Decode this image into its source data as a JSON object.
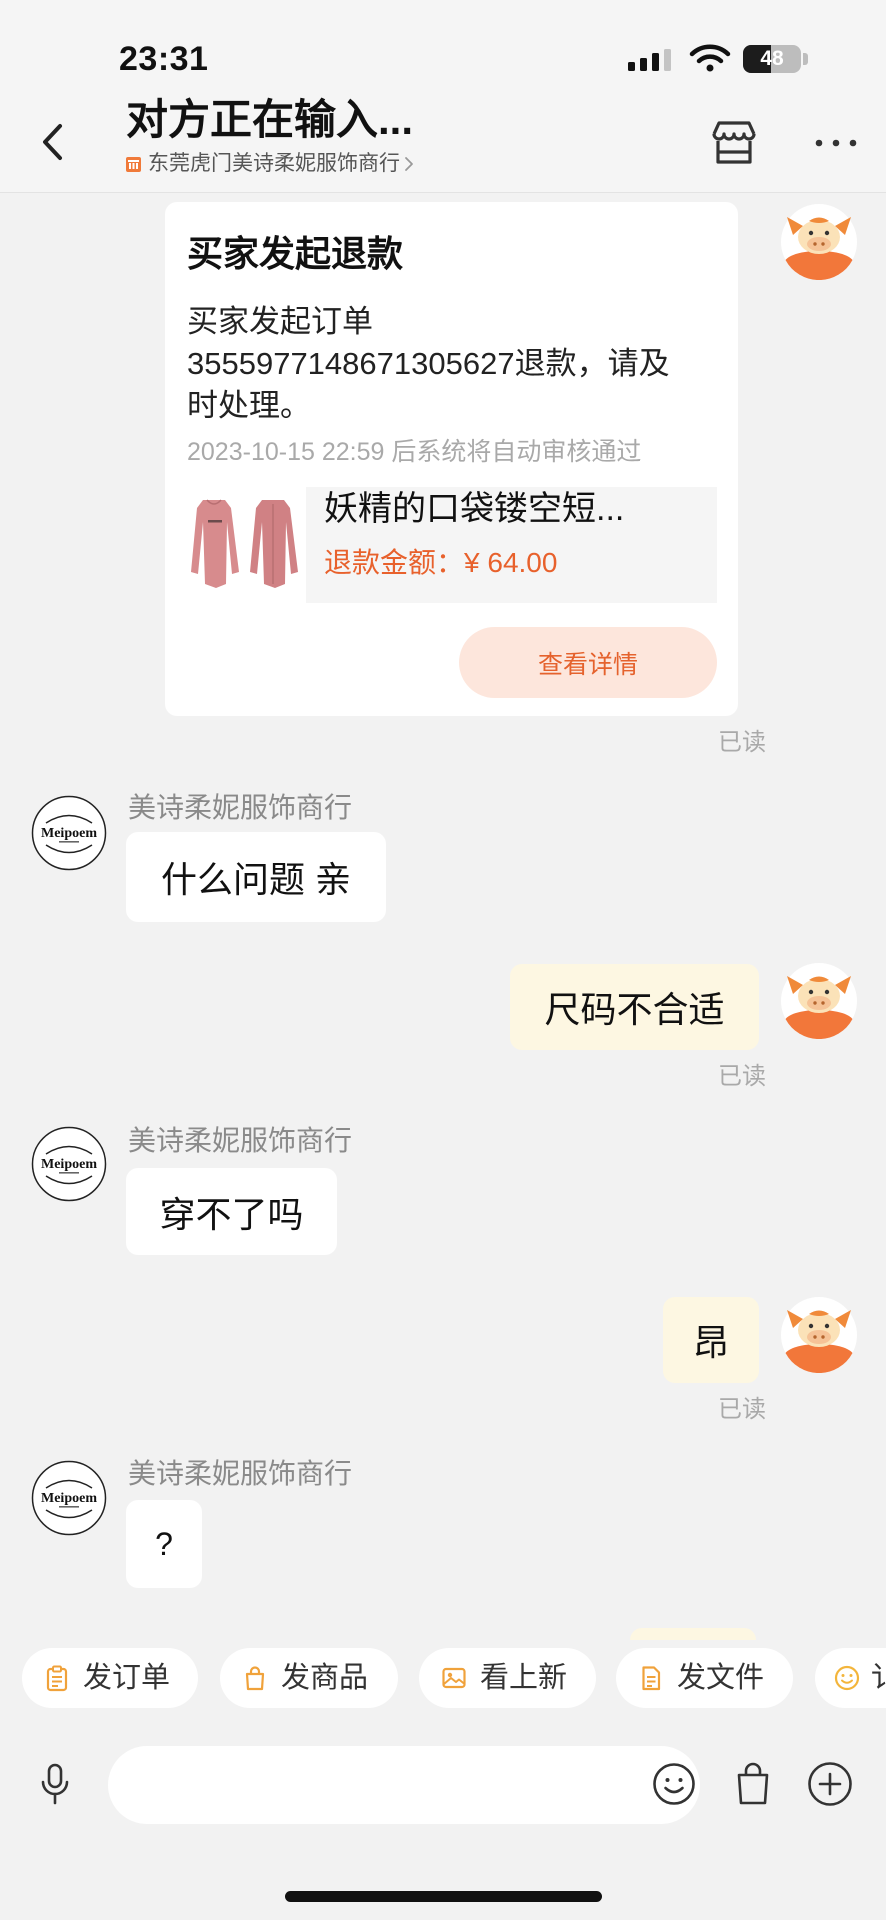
{
  "status_bar": {
    "time": "23:31",
    "battery_percent": "48",
    "battery_level": 0.48,
    "icons": [
      "cellular-signal-icon",
      "wifi-icon",
      "battery-icon"
    ]
  },
  "header": {
    "title": "对方正在输入...",
    "shop_name": "东莞虎门美诗柔妮服饰商行",
    "icons": {
      "back": "chevron-left-icon",
      "shop_badge": "shop-badge-icon",
      "store": "store-icon",
      "more": "more-dots-icon"
    }
  },
  "refund_card": {
    "title": "买家发起退款",
    "body_lines": [
      "买家发起订单",
      "3555977148671305627退款，请及",
      "时处理。"
    ],
    "deadline": "2023-10-15 22:59 后系统将自动审核通过",
    "product": {
      "title": "妖精的口袋镂空短...",
      "refund_label": "退款金额：",
      "refund_amount": "¥ 64.00"
    },
    "detail_button": "查看详情",
    "read_status": "已读"
  },
  "seller_avatar": {
    "logo_text": "Meipoem"
  },
  "messages": [
    {
      "side": "left",
      "sender": "美诗柔妮服饰商行",
      "text": "什么问题 亲"
    },
    {
      "side": "right",
      "text": "尺码不合适",
      "read_status": "已读"
    },
    {
      "side": "left",
      "sender": "美诗柔妮服饰商行",
      "text": "穿不了吗"
    },
    {
      "side": "right",
      "text": "昂",
      "read_status": "已读"
    },
    {
      "side": "left",
      "sender": "美诗柔妮服饰商行",
      "text": "?"
    }
  ],
  "quick_actions": [
    {
      "label": "发订单",
      "icon": "clipboard-icon"
    },
    {
      "label": "发商品",
      "icon": "shopping-bag-icon"
    },
    {
      "label": "看上新",
      "icon": "image-icon"
    },
    {
      "label": "发文件",
      "icon": "document-icon"
    },
    {
      "label": "讠",
      "icon": "smiley-icon"
    }
  ],
  "input_bar": {
    "value": "",
    "placeholder": "",
    "icons": [
      "microphone-icon",
      "emoji-icon",
      "shopping-bag-icon",
      "plus-circle-icon"
    ]
  },
  "colors": {
    "background": "#f2f2f2",
    "card": "#ffffff",
    "accent_orange": "#e8612c",
    "detail_button_bg": "#fde6dc",
    "outgoing_bubble": "#fdf7e2",
    "incoming_bubble": "#ffffff",
    "muted_text": "#a9a9a9",
    "quick_icon": "#f0a23b"
  }
}
